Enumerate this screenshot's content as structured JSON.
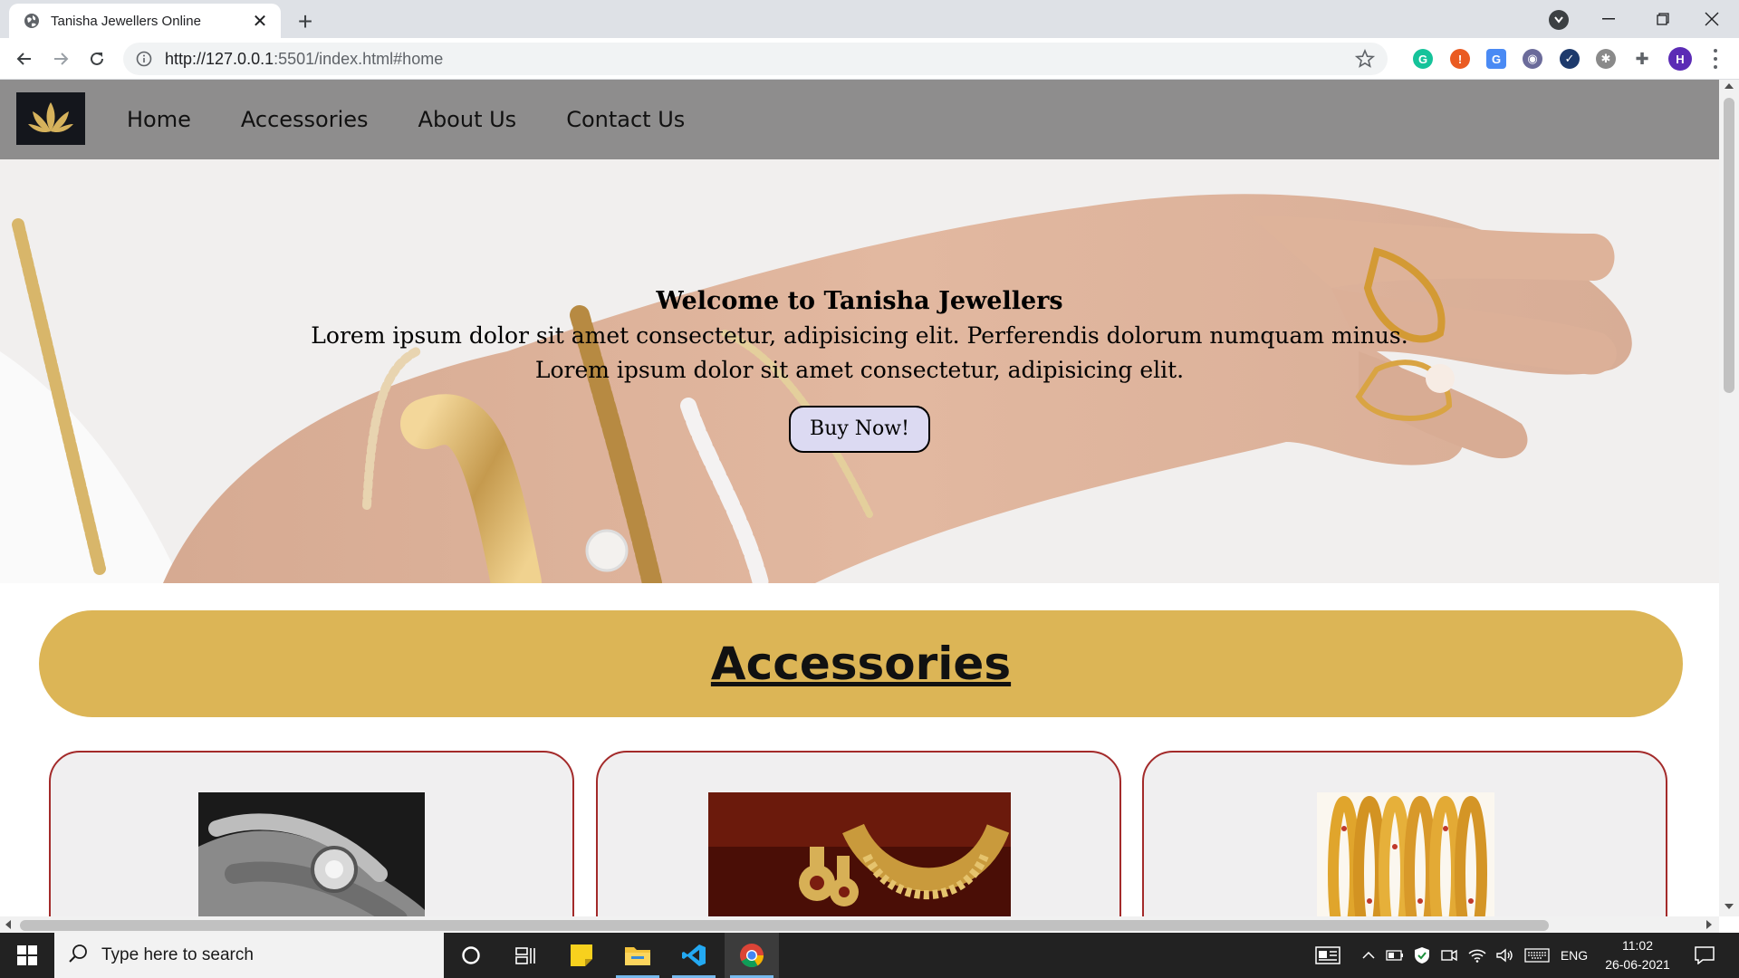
{
  "browser": {
    "tab_title": "Tanisha Jewellers Online",
    "url_host": "http://127.0.0.1",
    "url_rest": ":5501/index.html#home",
    "profile_initial": "H"
  },
  "site": {
    "nav": [
      "Home",
      "Accessories",
      "About Us",
      "Contact Us"
    ],
    "hero": {
      "title": "Welcome to Tanisha Jewellers",
      "line1": "Lorem ipsum dolor sit amet consectetur, adipisicing elit. Perferendis dolorum numquam minus.",
      "line2": "Lorem ipsum dolor sit amet consectetur, adipisicing elit.",
      "button": "Buy Now!"
    },
    "section_title": "Accessories",
    "products": [
      {
        "image": "ring-photo"
      },
      {
        "image": "necklace-set-photo"
      },
      {
        "image": "bangles-photo"
      }
    ]
  },
  "taskbar": {
    "search_placeholder": "Type here to search",
    "language": "ENG",
    "time": "11:02",
    "date": "26-06-2021"
  },
  "colors": {
    "accent_banner": "#dcb556",
    "card_border": "#a32a2a",
    "buy_button_bg": "#dcdaf2"
  }
}
